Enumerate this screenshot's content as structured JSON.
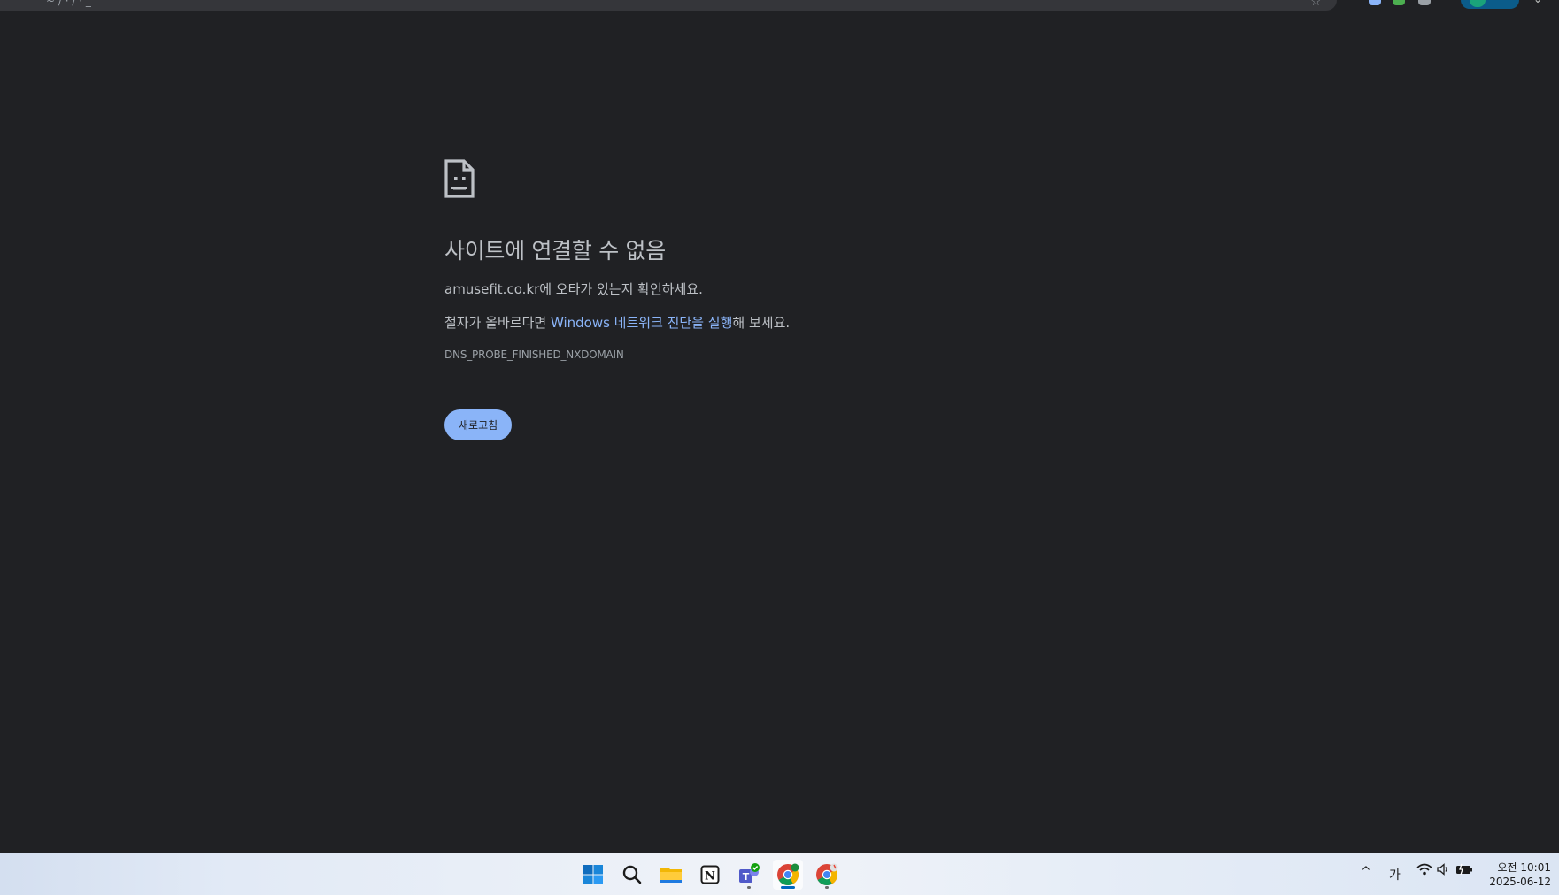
{
  "browser": {
    "url_fragment": "~ / · / · _",
    "star_icon": "star-icon",
    "menu_icon": "chevron-down-icon"
  },
  "error": {
    "icon": "sad-document-icon",
    "title": "사이트에 연결할 수 없음",
    "domain": "amusefit.co.kr",
    "typo_suffix": "에 오타가 있는지 확인하세요.",
    "spell_prefix": "철자가 올바르다면 ",
    "diagnostics_link": "Windows 네트워크 진단을 실행",
    "spell_suffix": "해 보세요.",
    "code": "DNS_PROBE_FINISHED_NXDOMAIN",
    "reload_label": "새로고침"
  },
  "taskbar": {
    "apps": [
      "start-icon",
      "search-icon",
      "file-explorer-icon",
      "notion-icon",
      "teams-icon",
      "chrome-icon",
      "chrome-icon"
    ],
    "tray": {
      "chevron": "^",
      "ime": "가"
    },
    "clock": {
      "time": "오전 10:01",
      "date": "2025-06-12"
    }
  },
  "colors": {
    "background": "#202124",
    "text": "#bdc1c6",
    "link": "#8ab4f8",
    "button": "#8ab4f8"
  }
}
